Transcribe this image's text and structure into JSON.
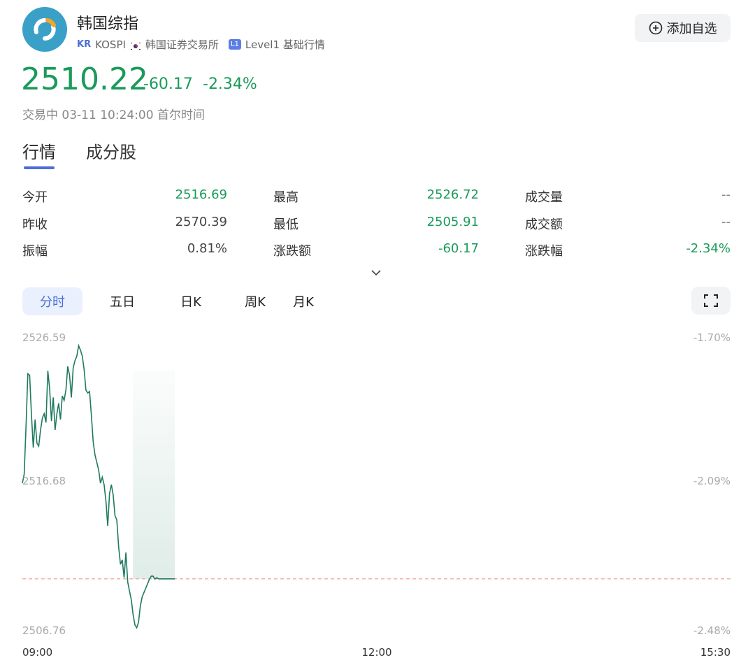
{
  "header": {
    "title": "韩国综指",
    "market_badge": "KR",
    "symbol": "KOSPI",
    "exchange": "韩国证券交易所",
    "level_badge": "L1",
    "level_text": "Level1 基础行情",
    "add_button_label": "添加自选"
  },
  "quote": {
    "price": "2510.22",
    "change": "-60.17",
    "change_pct": "-2.34%",
    "status": "交易中 03-11 10:24:00 首尔时间"
  },
  "tabs": [
    {
      "label": "行情",
      "active": true
    },
    {
      "label": "成分股",
      "active": false
    }
  ],
  "stats": [
    {
      "label": "今开",
      "value": "2516.69"
    },
    {
      "label": "最高",
      "value": "2526.72"
    },
    {
      "label": "成交量",
      "value": "--"
    },
    {
      "label": "昨收",
      "value": "2570.39"
    },
    {
      "label": "最低",
      "value": "2505.91"
    },
    {
      "label": "成交额",
      "value": "--"
    },
    {
      "label": "振幅",
      "value": "0.81%"
    },
    {
      "label": "涨跌额",
      "value": "-60.17"
    },
    {
      "label": "涨跌幅",
      "value": "-2.34%"
    }
  ],
  "period_tabs": [
    {
      "label": "分时",
      "active": true
    },
    {
      "label": "五日",
      "active": false
    },
    {
      "label": "日K",
      "active": false
    },
    {
      "label": "周K",
      "active": false
    },
    {
      "label": "月K",
      "active": false
    }
  ],
  "colors": {
    "down": "#1a9a5a",
    "line": "#1f7a5f",
    "accent": "#4a6fd8",
    "prev_close_line": "#f0a0a0"
  },
  "chart_data": {
    "type": "line",
    "title": "",
    "y_ticks_left": [
      "2526.59",
      "2516.68",
      "2506.76"
    ],
    "y_ticks_right": [
      "-1.70%",
      "-2.09%",
      "-2.48%"
    ],
    "x_ticks": [
      "09:00",
      "12:00",
      "15:30"
    ],
    "ylim": [
      2506.76,
      2526.59
    ],
    "reference_line": 2510.22,
    "series": [
      {
        "x": [
          "09:00",
          "09:01",
          "09:02",
          "09:03",
          "09:04",
          "09:05",
          "09:06",
          "09:07",
          "09:08",
          "09:09",
          "09:10",
          "09:11",
          "09:12",
          "09:13",
          "09:14",
          "09:15",
          "09:16",
          "09:17",
          "09:18",
          "09:19",
          "09:20",
          "09:21",
          "09:22",
          "09:23",
          "09:24",
          "09:25",
          "09:26",
          "09:27",
          "09:28",
          "09:29",
          "09:30",
          "09:31",
          "09:32",
          "09:33",
          "09:34",
          "09:35",
          "09:36",
          "09:37",
          "09:38",
          "09:39",
          "09:40",
          "09:41",
          "09:42",
          "09:43",
          "09:44",
          "09:45",
          "09:46",
          "09:47",
          "09:48",
          "09:49",
          "09:50",
          "09:51",
          "09:52",
          "09:53",
          "09:54",
          "09:55",
          "09:56",
          "09:57",
          "09:58",
          "09:59",
          "10:00",
          "10:01",
          "10:02",
          "10:03",
          "10:04",
          "10:05",
          "10:06",
          "10:07",
          "10:08",
          "10:09",
          "10:10",
          "10:11",
          "10:12",
          "10:13",
          "10:14",
          "10:15",
          "10:16",
          "10:17",
          "10:18",
          "10:19",
          "10:20",
          "10:21",
          "10:22",
          "10:23",
          "10:24"
        ],
        "values": [
          2516.7,
          2517.3,
          2520.5,
          2524.1,
          2524.0,
          2521.3,
          2519.1,
          2521.0,
          2519.4,
          2519.2,
          2520.3,
          2521.1,
          2521.4,
          2520.8,
          2524.3,
          2523.1,
          2520.9,
          2522.5,
          2520.3,
          2521.4,
          2522.1,
          2521.0,
          2522.6,
          2522.3,
          2523.0,
          2524.6,
          2524.0,
          2522.5,
          2524.5,
          2525.0,
          2525.3,
          2526.0,
          2525.7,
          2525.3,
          2524.4,
          2523.0,
          2522.8,
          2522.9,
          2521.3,
          2519.5,
          2518.6,
          2518.1,
          2517.6,
          2516.7,
          2517.1,
          2516.6,
          2515.5,
          2513.8,
          2516.0,
          2516.6,
          2515.9,
          2514.5,
          2514.2,
          2512.4,
          2511.2,
          2511.5,
          2510.3,
          2512.0,
          2510.0,
          2509.4,
          2508.8,
          2507.8,
          2507.1,
          2506.9,
          2507.3,
          2508.4,
          2509.0,
          2509.3,
          2509.6,
          2509.9,
          2510.2,
          2510.4,
          2510.4,
          2510.2,
          2510.3,
          2510.22,
          2510.22,
          2510.22,
          2510.22,
          2510.22,
          2510.22,
          2510.22,
          2510.22,
          2510.22,
          2510.22
        ]
      }
    ]
  }
}
